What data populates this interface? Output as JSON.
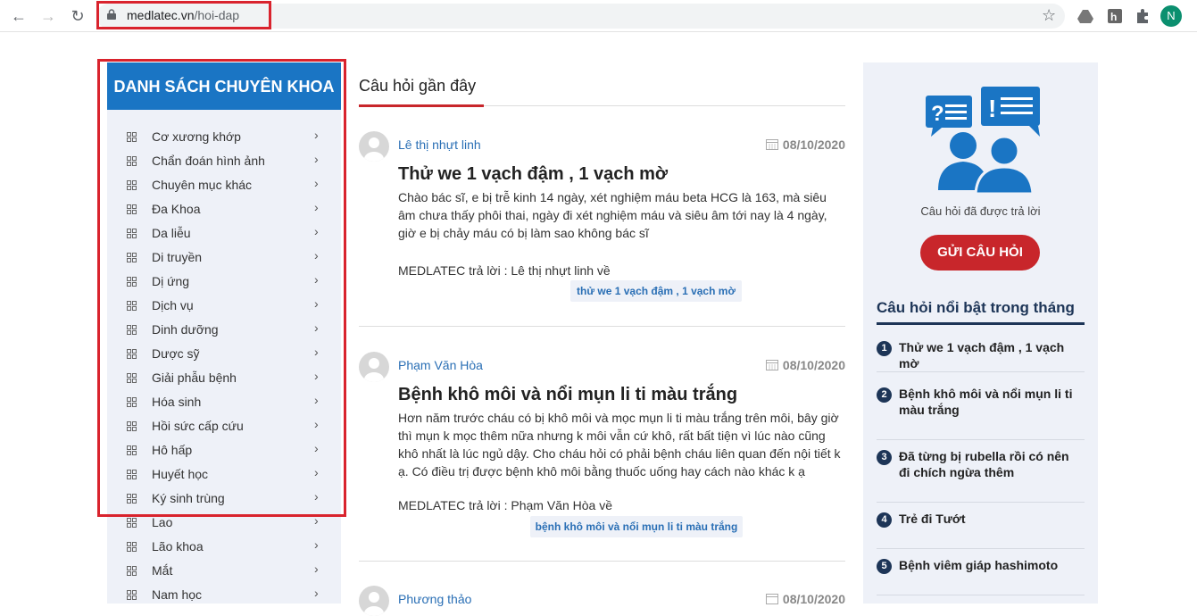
{
  "browser": {
    "domain": "medlatec.vn",
    "path": "/hoi-dap",
    "profile_initial": "N"
  },
  "sidebar": {
    "title": "DANH SÁCH CHUYÊN KHOA",
    "items": [
      {
        "label": "Cơ xương khớp"
      },
      {
        "label": "Chẩn đoán hình ảnh"
      },
      {
        "label": "Chuyên mục khác"
      },
      {
        "label": "Đa Khoa"
      },
      {
        "label": "Da liễu"
      },
      {
        "label": "Di truyền"
      },
      {
        "label": "Dị ứng"
      },
      {
        "label": "Dịch vụ"
      },
      {
        "label": "Dinh dưỡng"
      },
      {
        "label": "Dược sỹ"
      },
      {
        "label": "Giải phẫu bệnh"
      },
      {
        "label": "Hóa sinh"
      },
      {
        "label": "Hồi sức cấp cứu"
      },
      {
        "label": "Hô hấp"
      },
      {
        "label": "Huyết học"
      },
      {
        "label": "Ký sinh trùng"
      },
      {
        "label": "Lao"
      },
      {
        "label": "Lão khoa"
      },
      {
        "label": "Mắt"
      },
      {
        "label": "Nam học"
      }
    ]
  },
  "main": {
    "title": "Câu hỏi gần đây",
    "questions": [
      {
        "author": "Lê thị nhựt linh",
        "date": "08/10/2020",
        "title": "Thử we 1 vạch đậm , 1 vạch mờ",
        "body": "Chào bác sĩ, e bị trễ kinh 14 ngày, xét nghiệm máu beta HCG là 163, mà siêu âm chưa thấy phôi thai, ngày đi xét nghiệm máu và siêu âm tới nay là 4 ngày, giờ e bị chảy máu có bị làm sao không bác sĩ",
        "answer": "MEDLATEC trả lời : Lê thị nhựt linh về",
        "tag": "thử we 1 vạch đậm , 1 vạch mờ"
      },
      {
        "author": "Phạm Văn Hòa",
        "date": "08/10/2020",
        "title": "Bệnh khô môi và nổi mụn li ti màu trắng",
        "body": "Hơn năm trước cháu có bị khô môi và mọc mụn li ti màu trắng trên môi, bây giờ thì mụn k mọc thêm nữa nhưng k môi vẫn cứ khô, rất bất tiện vì lúc nào cũng khô nhất là lúc ngủ dậy. Cho cháu hỏi có phải bệnh cháu liên quan đến nội tiết k ạ. Có điều trị được bệnh khô môi bằng thuốc uống hay cách nào khác k ạ",
        "answer": "MEDLATEC trả lời : Phạm Văn Hòa về",
        "tag": "bệnh khô môi và nổi mụn li ti màu trắng"
      },
      {
        "author": "Phương thảo",
        "date": "08/10/2020"
      }
    ]
  },
  "right": {
    "answered_label": "Câu hỏi đã được trả lời",
    "ask_button": "GỬI CÂU HỎI",
    "hot_title": "Câu hỏi nổi bật trong tháng",
    "hot_items": [
      {
        "num": "1",
        "text": "Thử we 1 vạch đậm , 1 vạch mờ"
      },
      {
        "num": "2",
        "text": "Bệnh khô môi và nổi mụn li ti màu trắng"
      },
      {
        "num": "3",
        "text": "Đã từng bị rubella rồi có nên đi chích ngừa thêm"
      },
      {
        "num": "4",
        "text": "Trẻ đi Tướt"
      },
      {
        "num": "5",
        "text": "Bệnh viêm giáp hashimoto"
      }
    ]
  },
  "colors": {
    "brand_blue": "#1a75c4",
    "accent_red": "#c8262b",
    "navy": "#1d3557",
    "highlight_red": "#d9232d"
  }
}
